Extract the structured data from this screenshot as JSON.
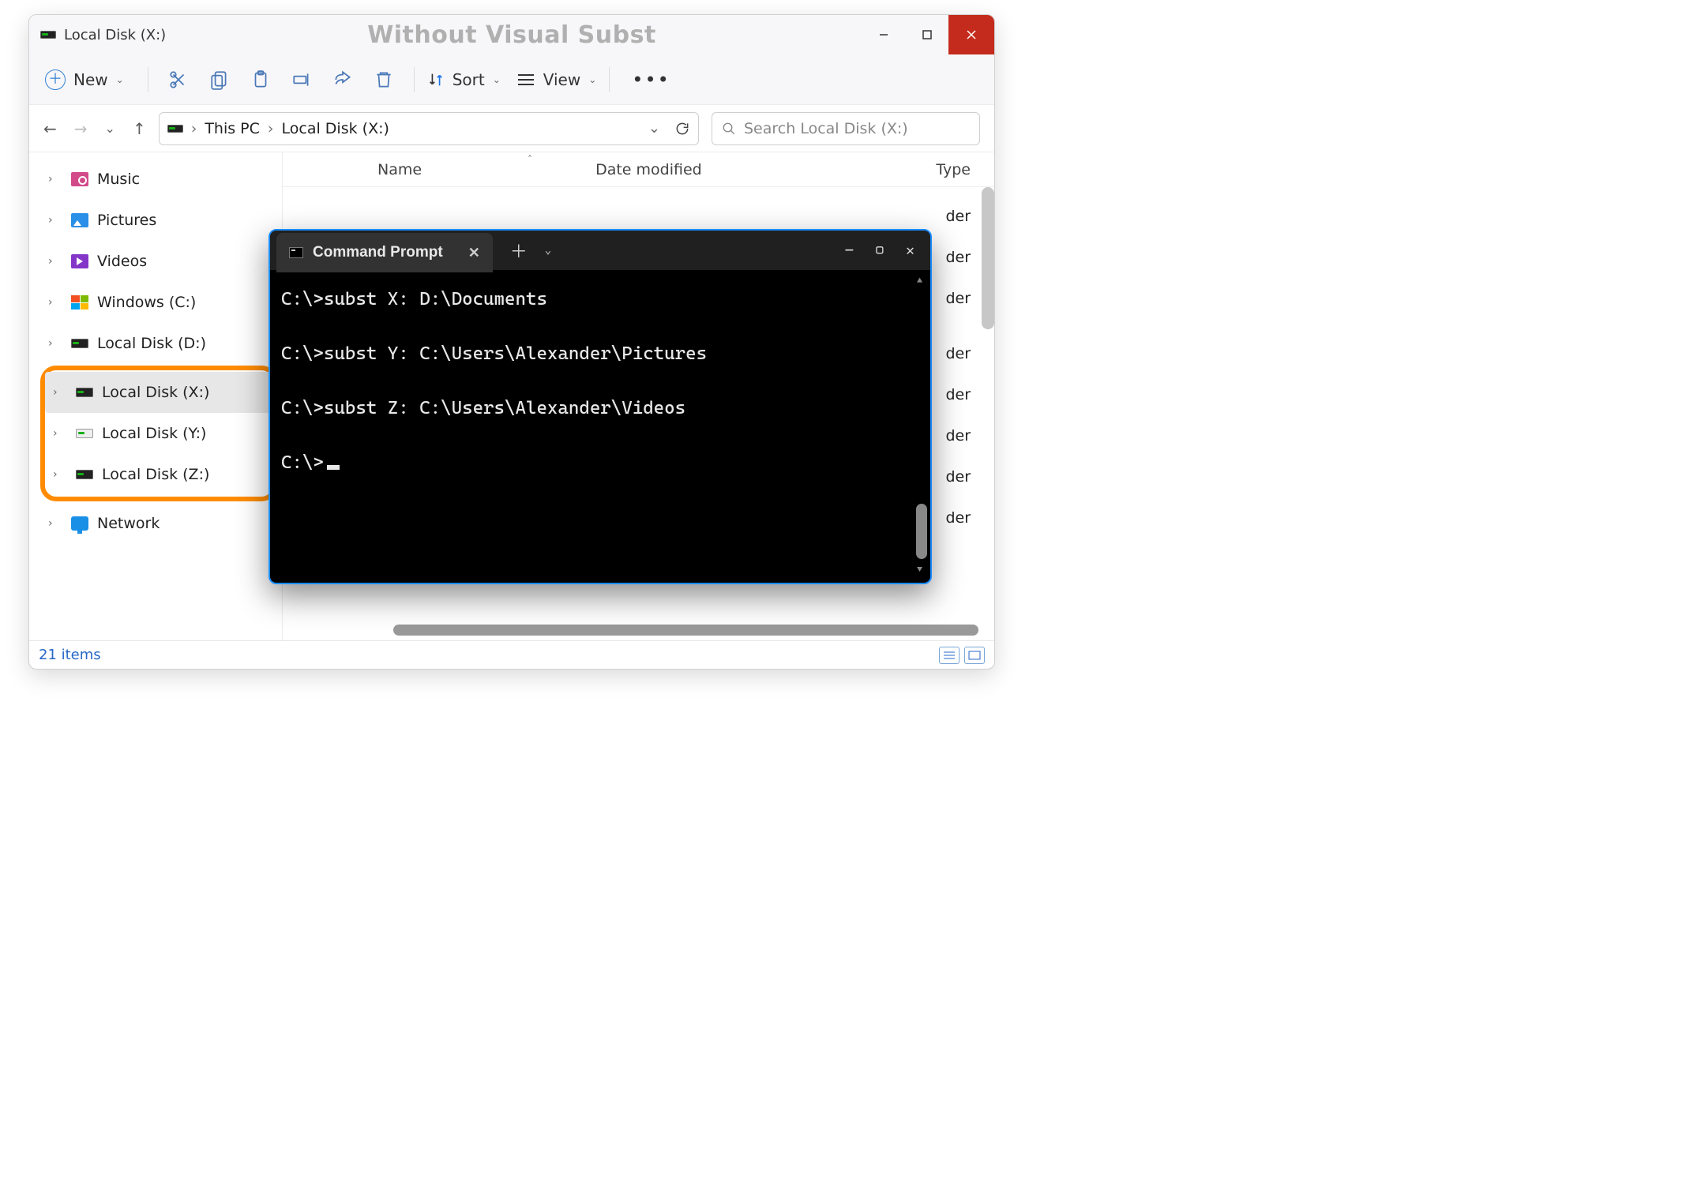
{
  "title": "Local Disk (X:)",
  "overlay_caption": "Without Visual Subst",
  "toolbar": {
    "new_label": "New",
    "sort_label": "Sort",
    "view_label": "View"
  },
  "nav": {
    "crumb1": "This PC",
    "crumb2": "Local Disk (X:)"
  },
  "search": {
    "placeholder": "Search Local Disk (X:)"
  },
  "columns": {
    "name": "Name",
    "date": "Date modified",
    "type": "Type"
  },
  "tree": {
    "items": [
      {
        "label": "Music",
        "icon": "music"
      },
      {
        "label": "Pictures",
        "icon": "pics"
      },
      {
        "label": "Videos",
        "icon": "vids"
      },
      {
        "label": "Windows (C:)",
        "icon": "winc"
      },
      {
        "label": "Local Disk (D:)",
        "icon": "disk"
      }
    ],
    "highlight": [
      {
        "label": "Local Disk (X:)",
        "icon": "disk",
        "selected": true
      },
      {
        "label": "Local Disk (Y:)",
        "icon": "diskw"
      },
      {
        "label": "Local Disk (Z:)",
        "icon": "disk"
      }
    ],
    "after": [
      {
        "label": "Network",
        "icon": "net"
      }
    ]
  },
  "status": {
    "count": "21 items"
  },
  "peek_type": "der",
  "cmd": {
    "tab": "Command Prompt",
    "lines": [
      "C:\\>subst X: D:\\Documents",
      "",
      "C:\\>subst Y: C:\\Users\\Alexander\\Pictures",
      "",
      "C:\\>subst Z: C:\\Users\\Alexander\\Videos",
      "",
      "C:\\>"
    ]
  }
}
